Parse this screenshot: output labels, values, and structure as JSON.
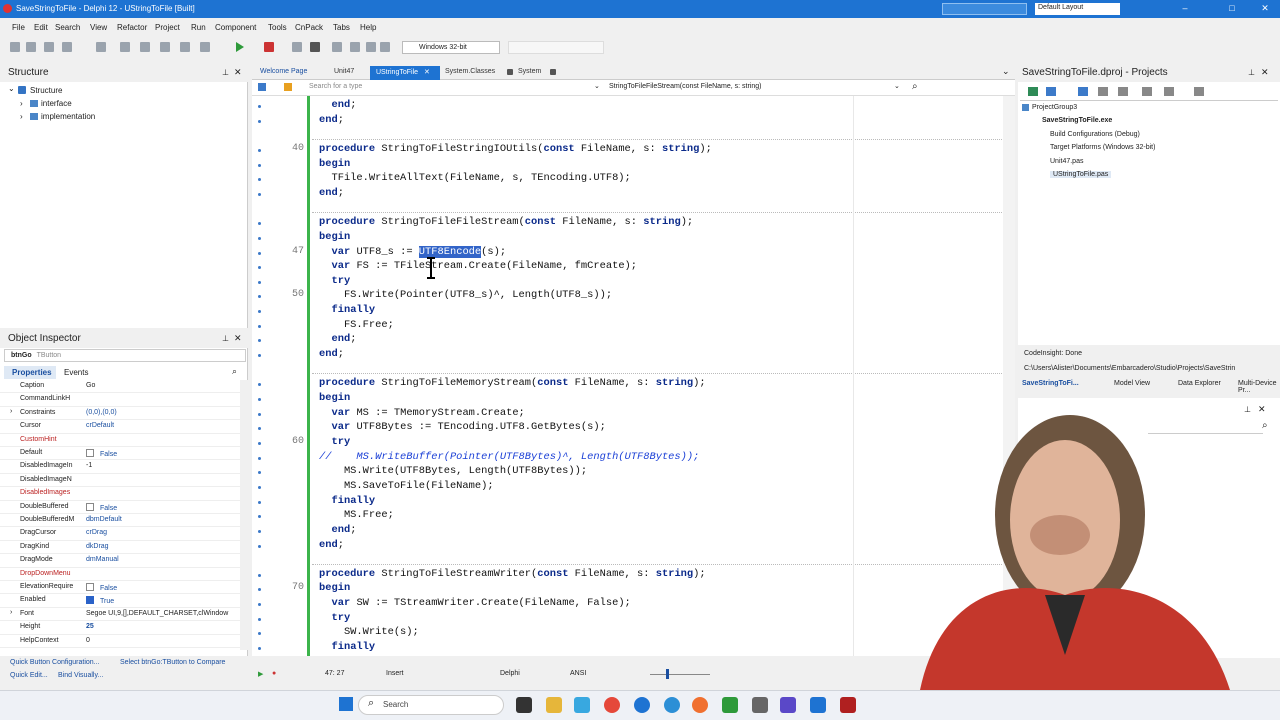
{
  "title": "SaveStringToFile - Delphi 12 - UStringToFile [Built]",
  "layout_select": "Default Layout",
  "menu": [
    "File",
    "Edit",
    "Search",
    "View",
    "Refactor",
    "Project",
    "Run",
    "Component",
    "Tools",
    "CnPack",
    "Tabs",
    "Help"
  ],
  "platform": "Windows 32-bit",
  "structure": {
    "title": "Structure",
    "root": "Structure",
    "items": [
      "interface",
      "implementation"
    ]
  },
  "object_inspector": {
    "title": "Object Inspector",
    "component": "btnGo",
    "component_type": "TButton",
    "tab_properties": "Properties",
    "tab_events": "Events",
    "rows": [
      {
        "k": "Caption",
        "v": "Go",
        "style": ""
      },
      {
        "k": "CommandLinkH",
        "v": "",
        "style": ""
      },
      {
        "k": "Constraints",
        "v": "(0,0),(0,0)",
        "style": "blue"
      },
      {
        "k": "Cursor",
        "v": "crDefault",
        "style": "blue"
      },
      {
        "k": "CustomHint",
        "v": "",
        "style": "red"
      },
      {
        "k": "Default",
        "v": "False",
        "style": "chk"
      },
      {
        "k": "DisabledImageIn",
        "v": "-1",
        "style": ""
      },
      {
        "k": "DisabledImageN",
        "v": "",
        "style": ""
      },
      {
        "k": "DisabledImages",
        "v": "",
        "style": "red"
      },
      {
        "k": "DoubleBuffered",
        "v": "False",
        "style": "chk"
      },
      {
        "k": "DoubleBufferedM",
        "v": "dbmDefault",
        "style": "blue"
      },
      {
        "k": "DragCursor",
        "v": "crDrag",
        "style": "blue"
      },
      {
        "k": "DragKind",
        "v": "dkDrag",
        "style": "blue"
      },
      {
        "k": "DragMode",
        "v": "dmManual",
        "style": "blue"
      },
      {
        "k": "DropDownMenu",
        "v": "",
        "style": "red"
      },
      {
        "k": "ElevationRequire",
        "v": "False",
        "style": "chk"
      },
      {
        "k": "Enabled",
        "v": "True",
        "style": "chkon"
      },
      {
        "k": "Font",
        "v": "Segoe UI,9,[],DEFAULT_CHARSET,clWindow",
        "style": ""
      },
      {
        "k": "Height",
        "v": "25",
        "style": "bold"
      },
      {
        "k": "HelpContext",
        "v": "0",
        "style": ""
      }
    ],
    "quick1": "Quick Button Configuration...",
    "quick2": "Select btnGo:TButton to Compare",
    "quick3": "Quick Edit...",
    "quick4": "Bind Visually..."
  },
  "tabs": [
    "Welcome Page",
    "Unit47",
    "UStringToFile",
    "System.Classes",
    "System"
  ],
  "nav": {
    "left": "Search for a type",
    "right": "StringToFileFileStream(const FileName, s: string)"
  },
  "line_numbers": [
    "40",
    "47",
    "50",
    "60",
    "70"
  ],
  "code": [
    "  end;",
    "end;",
    "",
    "procedure StringToFileStringIOUtils(const FileName, s: string);",
    "begin",
    "  TFile.WriteAllText(FileName, s, TEncoding.UTF8);",
    "end;",
    "",
    "procedure StringToFileFileStream(const FileName, s: string);",
    "begin",
    "  var UTF8_s := UTF8Encode(s);",
    "  var FS := TFileStream.Create(FileName, fmCreate);",
    "  try",
    "    FS.Write(Pointer(UTF8_s)^, Length(UTF8_s));",
    "  finally",
    "    FS.Free;",
    "  end;",
    "end;",
    "",
    "procedure StringToFileMemoryStream(const FileName, s: string);",
    "begin",
    "  var MS := TMemoryStream.Create;",
    "  var UTF8Bytes := TEncoding.UTF8.GetBytes(s);",
    "  try",
    "//    MS.WriteBuffer(Pointer(UTF8Bytes)^, Length(UTF8Bytes));",
    "    MS.Write(UTF8Bytes, Length(UTF8Bytes));",
    "    MS.SaveToFile(FileName);",
    "  finally",
    "    MS.Free;",
    "  end;",
    "end;",
    "",
    "procedure StringToFileStreamWriter(const FileName, s: string);",
    "begin",
    "  var SW := TStreamWriter.Create(FileName, False);",
    "  try",
    "    SW.Write(s);",
    "  finally"
  ],
  "status": {
    "pos": "47: 27",
    "mode": "Insert",
    "lang": "Delphi",
    "enc": "ANSI"
  },
  "projects": {
    "title": "SaveStringToFile.dproj - Projects",
    "items": [
      "ProjectGroup3",
      "SaveStringToFile.exe",
      "Build Configurations (Debug)",
      "Target Platforms (Windows 32-bit)",
      "Unit47.pas",
      "UStringToFile.pas"
    ],
    "codeinsight": "CodeInsight: Done",
    "path": "C:\\Users\\Alister\\Documents\\Embarcadero\\Studio\\Projects\\SaveStrin",
    "tabs": [
      "SaveStringToFi...",
      "Model View",
      "Data Explorer",
      "Multi-Device Pr..."
    ]
  },
  "taskbar_search": "Search"
}
